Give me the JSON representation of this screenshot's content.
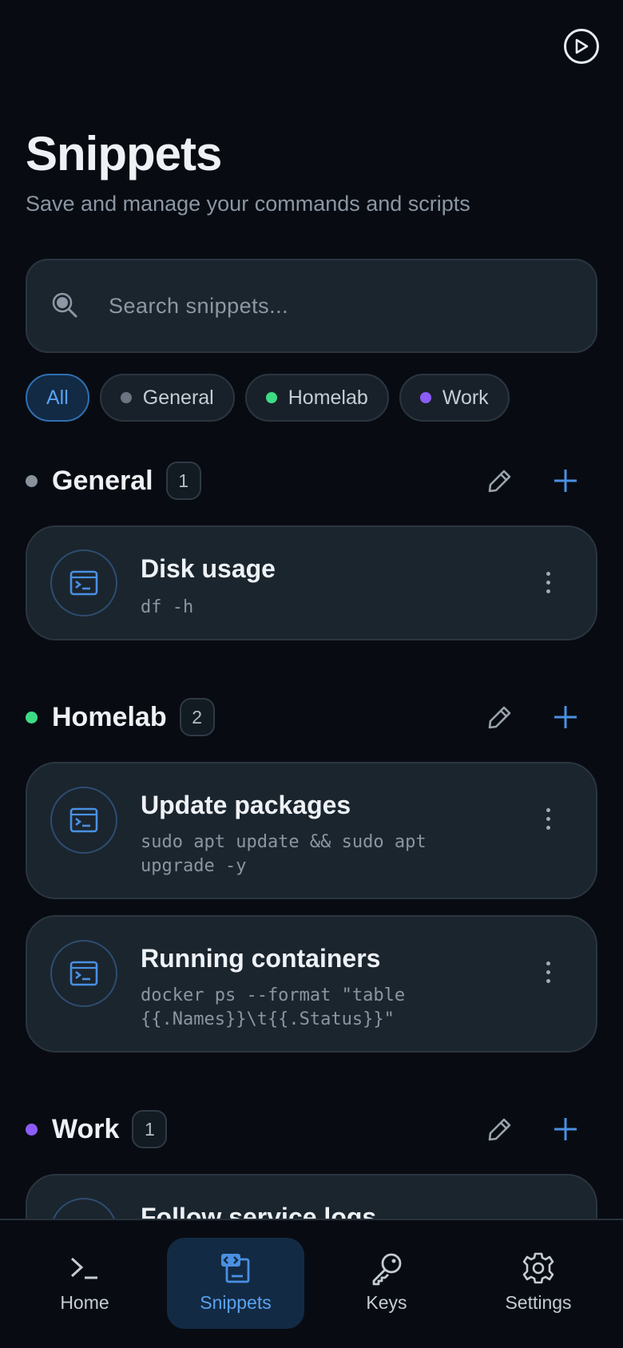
{
  "header": {
    "title": "Snippets",
    "subtitle": "Save and manage your commands and scripts",
    "action_icon": "play-circle-icon"
  },
  "search": {
    "placeholder": "Search snippets..."
  },
  "filters": [
    {
      "label": "All",
      "active": true
    },
    {
      "label": "General",
      "color": "#6b7480"
    },
    {
      "label": "Homelab",
      "color": "#3ddc84"
    },
    {
      "label": "Work",
      "color": "#8b5cf6"
    }
  ],
  "sections": [
    {
      "name": "General",
      "count": "1",
      "color": "#8a929c",
      "snippets": [
        {
          "title": "Disk usage",
          "command": "df -h"
        }
      ]
    },
    {
      "name": "Homelab",
      "count": "2",
      "color": "#3ddc84",
      "snippets": [
        {
          "title": "Update packages",
          "command": "sudo apt update && sudo apt upgrade -y"
        },
        {
          "title": "Running containers",
          "command": "docker ps --format \"table {{.Names}}\\t{{.Status}}\""
        }
      ]
    },
    {
      "name": "Work",
      "count": "1",
      "color": "#8b5cf6",
      "snippets": [
        {
          "title": "Follow service logs",
          "command": ""
        }
      ]
    }
  ],
  "bottom_nav": [
    {
      "label": "Home",
      "icon": "terminal-icon"
    },
    {
      "label": "Snippets",
      "icon": "code-file-icon",
      "active": true
    },
    {
      "label": "Keys",
      "icon": "key-icon"
    },
    {
      "label": "Settings",
      "icon": "gear-icon"
    }
  ],
  "colors": {
    "accent": "#4a90e2",
    "background": "#080c12",
    "card": "#1b252e"
  }
}
